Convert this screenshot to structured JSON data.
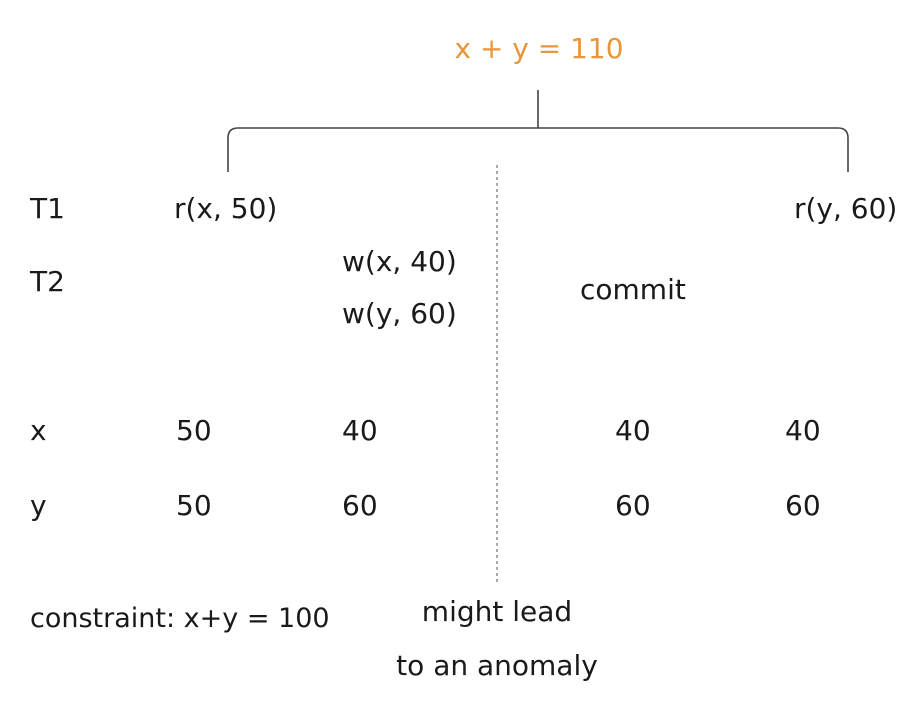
{
  "sum_label": "x + y = 110",
  "accent_color": "#E8963A",
  "rows": {
    "t1_label": "T1",
    "t2_label": "T2",
    "x_label": "x",
    "y_label": "y"
  },
  "t1_ops": [
    "r(x, 50)",
    "r(y, 60)"
  ],
  "t2_ops": [
    "w(x, 40)",
    "w(y, 60)",
    "commit"
  ],
  "x_values": [
    "50",
    "40",
    "40",
    "40"
  ],
  "y_values": [
    "50",
    "60",
    "60",
    "60"
  ],
  "constraint": "constraint: x+y = 100",
  "anomaly_note": {
    "line1": "might lead",
    "line2": "to an anomaly"
  }
}
